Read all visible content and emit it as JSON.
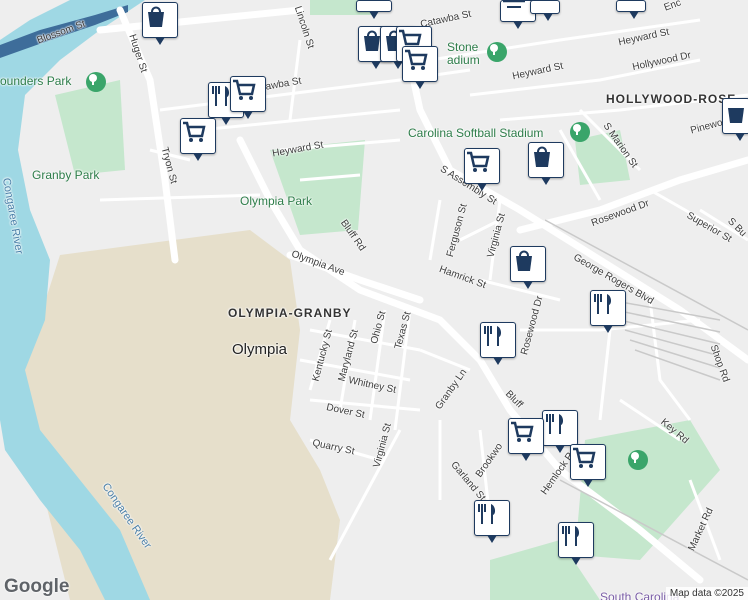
{
  "colors": {
    "water": "#9fd8e4",
    "park": "#c5e7cd",
    "land": "#eeeeee",
    "sand": "#e8e0cc",
    "road": "#ffffff",
    "rail": "#c9c9c9",
    "pin_border": "#1e3a5f",
    "park_pin": "#3aa56a"
  },
  "streets": [
    {
      "name": "Blossom St",
      "icon": null
    },
    {
      "name": "Huger St"
    },
    {
      "name": "Lincoln St"
    },
    {
      "name": "Catawba St"
    },
    {
      "name": "Catawba St"
    },
    {
      "name": "Heyward St"
    },
    {
      "name": "Heyward St"
    },
    {
      "name": "Heyward St"
    },
    {
      "name": "Hollywood Dr"
    },
    {
      "name": "Tryon St"
    },
    {
      "name": "Bluff Rd"
    },
    {
      "name": "Olympia Ave"
    },
    {
      "name": "S Assembly St"
    },
    {
      "name": "Ferguson St"
    },
    {
      "name": "Virginia St"
    },
    {
      "name": "Hamrick St"
    },
    {
      "name": "Rosewood Dr"
    },
    {
      "name": "Rosewood Dr"
    },
    {
      "name": "George Rogers Blvd"
    },
    {
      "name": "S Marion St"
    },
    {
      "name": "Superior St"
    },
    {
      "name": "Pinewood"
    },
    {
      "name": "Kentucky St"
    },
    {
      "name": "Maryland St"
    },
    {
      "name": "Ohio St"
    },
    {
      "name": "Texas St"
    },
    {
      "name": "Whitney St"
    },
    {
      "name": "Dover St"
    },
    {
      "name": "Virginia St"
    },
    {
      "name": "Quarry St"
    },
    {
      "name": "Granby Ln"
    },
    {
      "name": "Bluff"
    },
    {
      "name": "Brookwo"
    },
    {
      "name": "Hemlock Rd"
    },
    {
      "name": "Garland St"
    },
    {
      "name": "Key Rd"
    },
    {
      "name": "Market Rd"
    },
    {
      "name": "Shop Rd"
    },
    {
      "name": "S Bu"
    },
    {
      "name": "Enc"
    }
  ],
  "places": {
    "founders_park": "ounders Park",
    "granby_park": "Granby Park",
    "olympia_park": "Olympia Park",
    "olympia_granby": "OLYMPIA-GRANBY",
    "olympia": "Olympia",
    "hollywood_rose": "HOLLYWOOD-ROSE",
    "stone_stadium_1": "Stone",
    "stone_stadium_2": "adium",
    "carolina_softball": "Carolina Softball Stadium",
    "congaree_river_1": "Congaree River",
    "congaree_river_2": "Congaree River",
    "south_carolina": "South Carolina"
  },
  "pins": [
    {
      "type": "shopping-bag"
    },
    {
      "type": "shopping-bag"
    },
    {
      "type": "shopping-bag"
    },
    {
      "type": "shopping-cart"
    },
    {
      "type": "shopping-cart"
    },
    {
      "type": "shopping-cart"
    },
    {
      "type": "shopping-cart"
    },
    {
      "type": "restaurant"
    },
    {
      "type": "shopping-cart"
    },
    {
      "type": "shopping-cart"
    },
    {
      "type": "shopping-bag"
    },
    {
      "type": "shopping-bag"
    },
    {
      "type": "restaurant"
    },
    {
      "type": "restaurant"
    },
    {
      "type": "shopping-cart"
    },
    {
      "type": "restaurant"
    },
    {
      "type": "shopping-cart"
    },
    {
      "type": "shopping-cart"
    },
    {
      "type": "restaurant"
    },
    {
      "type": "restaurant"
    },
    {
      "type": "shopping-bag"
    },
    {
      "type": "shopping-cart"
    },
    {
      "type": "shopping-bag"
    }
  ],
  "logo": "Google",
  "attribution": "Map data ©2025"
}
